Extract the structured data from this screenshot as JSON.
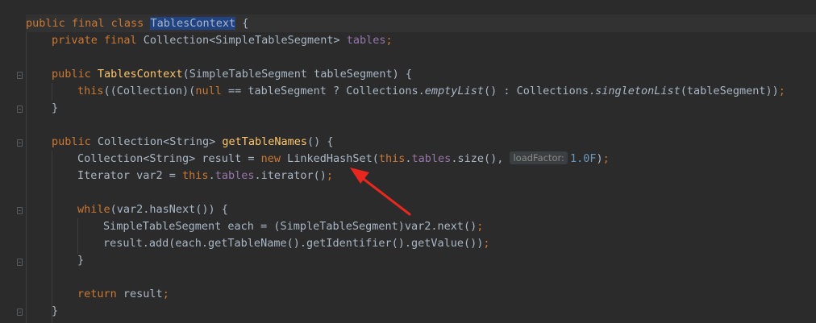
{
  "code": {
    "l1": {
      "a": "public final class ",
      "cls": "TablesContext",
      "b": " {"
    },
    "l2": {
      "kw": "private final ",
      "type": "Collection<SimpleTableSegment> ",
      "fld": "tables",
      "semi": ";"
    },
    "l3": {
      "kw": "public ",
      "fn": "TablesContext",
      "rest": "(SimpleTableSegment tableSegment) {"
    },
    "l4": {
      "kw": "this",
      "p1": "((Collection)(",
      "kw2": "null",
      "p2": " == tableSegment ? Collections.",
      "it1": "emptyList",
      "p3": "() : Collections.",
      "it2": "singletonList",
      "p4": "(tableSegment))",
      "semi": ";"
    },
    "l5": {
      "t": "}"
    },
    "l6": {
      "kw": "public ",
      "type": "Collection<String> ",
      "fn": "getTableNames",
      "rest": "() {"
    },
    "l7": {
      "a": "Collection<String> result = ",
      "kw": "new ",
      "b": "LinkedHashSet(",
      "kw2": "this",
      "dot": ".",
      "fld": "tables",
      "c": ".size(), ",
      "hint": "loadFactor:",
      "num": "1.0F",
      "d": ")",
      "semi": ";"
    },
    "l8": {
      "a": "Iterator var2 = ",
      "kw": "this",
      "dot": ".",
      "fld": "tables",
      "b": ".iterator()",
      "semi": ";"
    },
    "l9": {
      "kw": "while",
      "rest": "(var2.hasNext()) {"
    },
    "l10": {
      "a": "SimpleTableSegment each = (SimpleTableSegment)var2.next()",
      "semi": ";"
    },
    "l11": {
      "a": "result.add(each.getTableName().getIdentifier().getValue())",
      "semi": ";"
    },
    "l12": {
      "t": "}"
    },
    "l13": {
      "kw": "return ",
      "a": "result",
      "semi": ";"
    },
    "l14": {
      "t": "}"
    }
  },
  "colors": {
    "background": "#2b2b2b",
    "keyword": "#cc7832",
    "method": "#ffc66d",
    "field": "#9876aa",
    "number": "#6897bb",
    "text": "#a9b7c6",
    "selection": "#214283",
    "arrow": "#e8281e"
  }
}
